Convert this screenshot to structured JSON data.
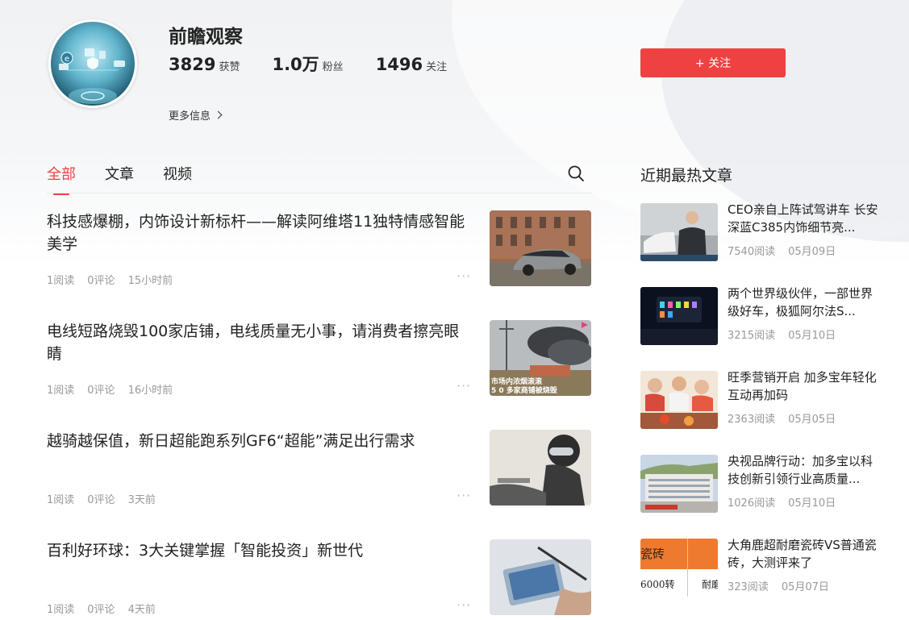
{
  "profile": {
    "name": "前瞻观察",
    "stats": [
      {
        "num": "3829",
        "label": "获赞"
      },
      {
        "num": "1.0万",
        "label": "粉丝"
      },
      {
        "num": "1496",
        "label": "关注"
      }
    ],
    "more_info": "更多信息",
    "follow_label": "+ 关注"
  },
  "tabs": [
    {
      "label": "全部",
      "active": true
    },
    {
      "label": "文章",
      "active": false
    },
    {
      "label": "视频",
      "active": false
    }
  ],
  "articles": [
    {
      "title": "科技感爆棚，内饰设计新标杆——解读阿维塔11独特情感智能美学",
      "reads": "1阅读",
      "comments": "0评论",
      "time": "15小时前"
    },
    {
      "title": "电线短路烧毁100家店铺，电线质量无小事，请消费者擦亮眼睛",
      "reads": "1阅读",
      "comments": "0评论",
      "time": "16小时前",
      "thumb_caption_1": "市场内浓烟滚滚",
      "thumb_caption_2": "5 0 多家商铺被烧毁"
    },
    {
      "title": "越骑越保值，新日超能跑系列GF6“超能”满足出行需求",
      "reads": "1阅读",
      "comments": "0评论",
      "time": "3天前"
    },
    {
      "title": "百利好环球：3大关键掌握「智能投资」新世代",
      "reads": "1阅读",
      "comments": "0评论",
      "time": "4天前"
    }
  ],
  "hot": {
    "title": "近期最热文章",
    "items": [
      {
        "title": "CEO亲自上阵试驾讲车 长安深蓝C385内饰细节亮...",
        "reads": "7540阅读",
        "date": "05月09日"
      },
      {
        "title": "两个世界级伙伴，一部世界级好车，极狐阿尔法S...",
        "reads": "3215阅读",
        "date": "05月10日"
      },
      {
        "title": "旺季营销开启 加多宝年轻化互动再加码",
        "reads": "2363阅读",
        "date": "05月05日"
      },
      {
        "title": "央视品牌行动：加多宝以科技创新引领行业高质量...",
        "reads": "1026阅读",
        "date": "05月10日"
      },
      {
        "title": "大角鹿超耐磨瓷砖VS普通瓷砖，大测评来了",
        "reads": "323阅读",
        "date": "05月07日",
        "thumb_text_1": "瓷砖",
        "thumb_text_2": "6000转",
        "thumb_text_3": "耐磨"
      }
    ]
  },
  "icons": {
    "search": "search-icon",
    "chevron": "chevron-right-icon",
    "more": "more-dots-icon"
  },
  "colors": {
    "accent": "#f04142"
  }
}
